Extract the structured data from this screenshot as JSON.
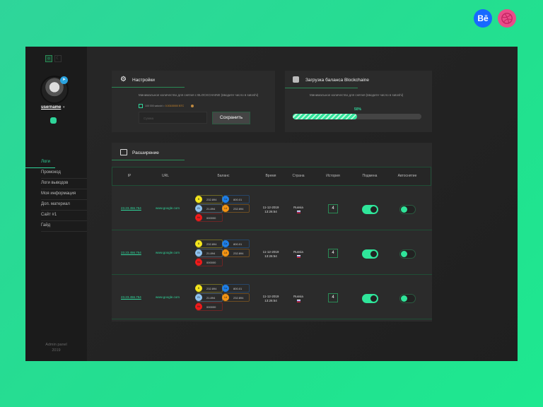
{
  "social": {
    "behance": "Bē",
    "dribbble": "dribbble"
  },
  "sidebar": {
    "username": "username",
    "menu": [
      "Логи",
      "Промокод",
      "Логи выводов",
      "Моя информация",
      "Доп. материал",
      "Сайт #1",
      "Гайд"
    ],
    "footer_line1": "Admin panel",
    "footer_line2": "2019"
  },
  "settings": {
    "title": "Настройки",
    "desc": "Минимальное количество для снятия с BLOCKCHAINE (вводите число в satoshi)",
    "check_text": "100 000 satoshi = ",
    "btc_text": "0.00100000 BTC",
    "input_placeholder": "Сумма",
    "save_label": "Сохранить"
  },
  "blockchain": {
    "title": "Загрузка баланса Blockchaine",
    "desc": "Минимальное количество для снятия (вводите число в satoshi)",
    "progress_label": "50%",
    "progress": 0.5
  },
  "extension": {
    "title": "Расширение",
    "columns": [
      "IP",
      "URL",
      "Баланс",
      "Время",
      "Страна",
      "История",
      "Подмена",
      "Автоснятие"
    ],
    "rows": [
      {
        "ip": "23.23.456.754",
        "url": "www.google.com",
        "coins": [
          {
            "sym": "B",
            "val": "232.894",
            "color": "#f5e61c"
          },
          {
            "sym": "Ca",
            "val": "800.01",
            "color": "#1e7fe8"
          },
          {
            "sym": "Et",
            "val": "21.894",
            "color": "#8fc3f0"
          },
          {
            "sym": "Lit",
            "val": "232.894",
            "color": "#f39313"
          },
          {
            "sym": "Hd",
            "val": "000000",
            "color": "#f01a1a"
          }
        ],
        "date": "11-12-2019",
        "time": "13:26:54",
        "country": "Russia",
        "history": "4",
        "swap": true,
        "auto": false
      },
      {
        "ip": "23.23.456.754",
        "url": "www.google.com",
        "coins": [
          {
            "sym": "B",
            "val": "232.894",
            "color": "#f5e61c"
          },
          {
            "sym": "Ca",
            "val": "800.01",
            "color": "#1e7fe8"
          },
          {
            "sym": "Et",
            "val": "21.894",
            "color": "#8fc3f0"
          },
          {
            "sym": "Lit",
            "val": "232.894",
            "color": "#f39313"
          },
          {
            "sym": "Hd",
            "val": "000000",
            "color": "#f01a1a"
          }
        ],
        "date": "11-12-2019",
        "time": "13:26:54",
        "country": "Russia",
        "history": "4",
        "swap": true,
        "auto": false
      },
      {
        "ip": "23.23.456.754",
        "url": "www.google.com",
        "coins": [
          {
            "sym": "B",
            "val": "232.894",
            "color": "#f5e61c"
          },
          {
            "sym": "Ca",
            "val": "800.01",
            "color": "#1e7fe8"
          },
          {
            "sym": "Et",
            "val": "21.894",
            "color": "#8fc3f0"
          },
          {
            "sym": "Lit",
            "val": "232.894",
            "color": "#f39313"
          },
          {
            "sym": "Hd",
            "val": "000000",
            "color": "#f01a1a"
          }
        ],
        "date": "11-12-2019",
        "time": "13:26:54",
        "country": "Russia",
        "history": "4",
        "swap": true,
        "auto": false
      }
    ]
  }
}
